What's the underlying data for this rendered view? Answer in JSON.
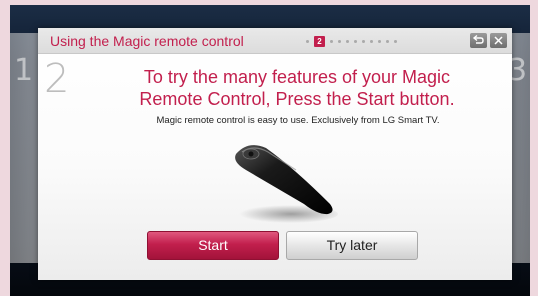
{
  "dialog": {
    "title": "Using the Magic remote control",
    "current_page": "2",
    "step_number": "2",
    "headline_line1": "To try the many features of your Magic",
    "headline_line2": "Remote Control, Press the Start button.",
    "subtext": "Magic remote control is easy to use. Exclusively from LG Smart TV.",
    "back_icon": "back-arrow-icon",
    "close_icon": "close-icon"
  },
  "buttons": {
    "start_label": "Start",
    "later_label": "Try later"
  },
  "side_pages": {
    "prev_number": "1",
    "next_number": "3"
  },
  "colors": {
    "accent": "#c21f4d",
    "screen_bg": "#0f1b2e",
    "dialog_bg": "#ffffff"
  }
}
